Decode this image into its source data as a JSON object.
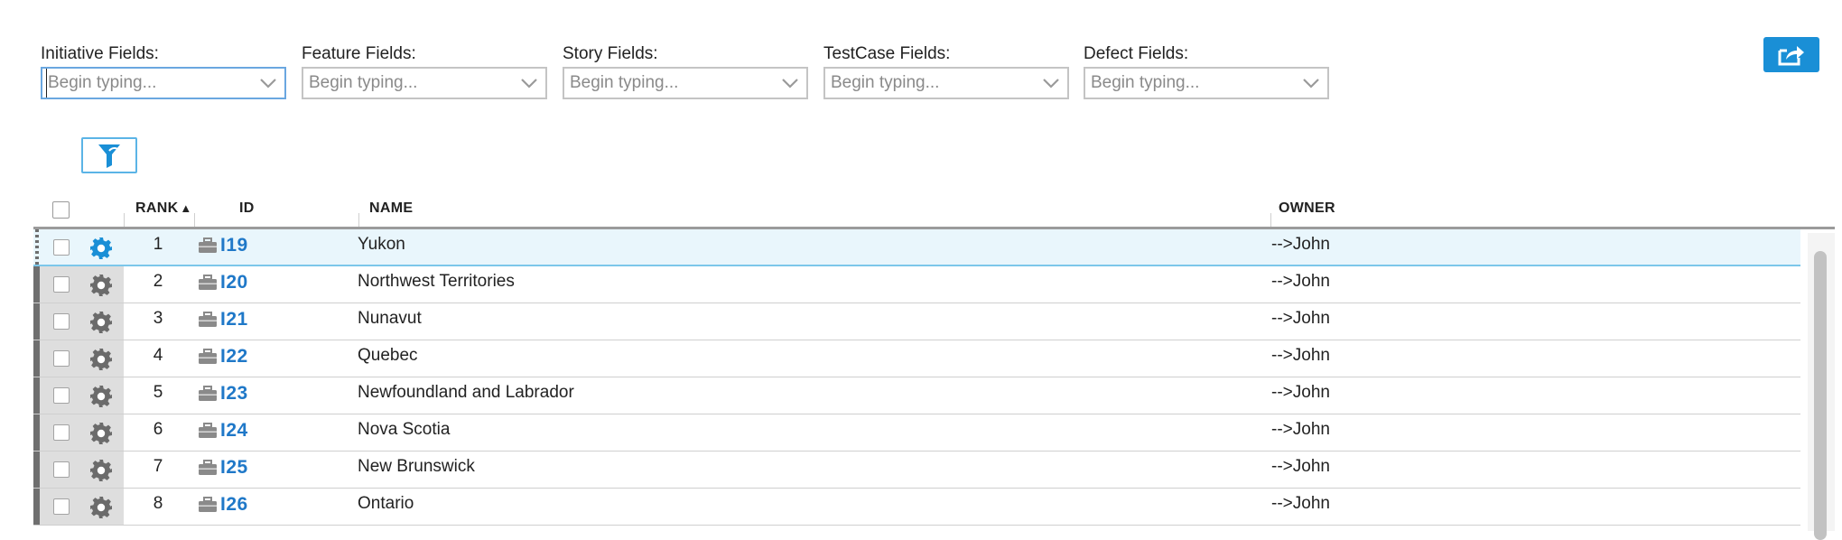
{
  "pickers": [
    {
      "label": "Initiative Fields:",
      "placeholder": "Begin typing...",
      "focused": true
    },
    {
      "label": "Feature Fields:",
      "placeholder": "Begin typing...",
      "focused": false
    },
    {
      "label": "Story Fields:",
      "placeholder": "Begin typing...",
      "focused": false
    },
    {
      "label": "TestCase Fields:",
      "placeholder": "Begin typing...",
      "focused": false
    },
    {
      "label": "Defect Fields:",
      "placeholder": "Begin typing...",
      "focused": false
    }
  ],
  "toolbar": {
    "export_icon": "export-icon",
    "filter_icon": "filter-icon"
  },
  "grid": {
    "columns": {
      "rank": "RANK",
      "sort_indicator": "▲",
      "id": "ID",
      "name": "NAME",
      "owner": "OWNER"
    },
    "rows": [
      {
        "rank": "1",
        "id": "I19",
        "name": "Yukon",
        "owner": "-->John",
        "selected": true
      },
      {
        "rank": "2",
        "id": "I20",
        "name": "Northwest Territories",
        "owner": "-->John"
      },
      {
        "rank": "3",
        "id": "I21",
        "name": "Nunavut",
        "owner": "-->John"
      },
      {
        "rank": "4",
        "id": "I22",
        "name": "Quebec",
        "owner": "-->John"
      },
      {
        "rank": "5",
        "id": "I23",
        "name": "Newfoundland and Labrador",
        "owner": "-->John"
      },
      {
        "rank": "6",
        "id": "I24",
        "name": "Nova Scotia",
        "owner": "-->John"
      },
      {
        "rank": "7",
        "id": "I25",
        "name": "New Brunswick",
        "owner": "-->John"
      },
      {
        "rank": "8",
        "id": "I26",
        "name": "Ontario",
        "owner": "-->John"
      }
    ]
  },
  "colors": {
    "accent": "#1a8fd6",
    "id_link": "#1f78c8",
    "selected_row": "#e9f6fc"
  }
}
